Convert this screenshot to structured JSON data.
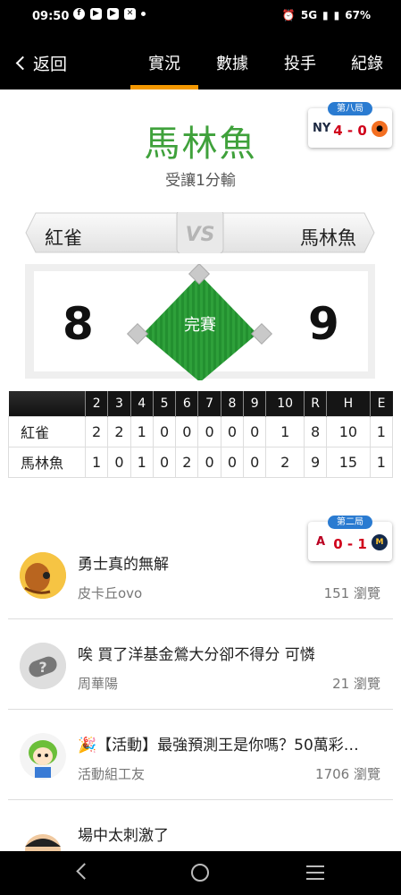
{
  "status_bar": {
    "time": "09:50",
    "network": "5G",
    "battery": "67%"
  },
  "nav": {
    "back_label": "返回",
    "tabs": [
      {
        "label": "實況",
        "active": true
      },
      {
        "label": "數據",
        "active": false
      },
      {
        "label": "投手",
        "active": false
      },
      {
        "label": "紀錄",
        "active": false
      }
    ],
    "accent_color": "#f39800"
  },
  "result": {
    "winner": "馬林魚",
    "subtitle": "受讓1分輸",
    "winner_color": "#3fa13b"
  },
  "mini_score_1": {
    "inning": "第八局",
    "score": "4 - 0",
    "away_logo": "yankees-logo",
    "home_logo": "orioles-logo"
  },
  "mini_score_2": {
    "inning": "第二局",
    "score": "0 - 1",
    "away_logo": "angels-logo",
    "home_logo": "brewers-logo"
  },
  "matchup": {
    "away_team": "紅雀",
    "home_team": "馬林魚",
    "vs": "VS",
    "away_score": "8",
    "home_score": "9",
    "status": "完賽"
  },
  "box_score": {
    "columns": [
      "2",
      "3",
      "4",
      "5",
      "6",
      "7",
      "8",
      "9",
      "10",
      "R",
      "H",
      "E"
    ],
    "rows": [
      {
        "team": "紅雀",
        "cells": [
          "2",
          "2",
          "1",
          "0",
          "0",
          "0",
          "0",
          "0",
          "1",
          "8",
          "10",
          "1"
        ]
      },
      {
        "team": "馬林魚",
        "cells": [
          "1",
          "0",
          "1",
          "0",
          "2",
          "0",
          "0",
          "0",
          "2",
          "9",
          "15",
          "1"
        ]
      }
    ]
  },
  "posts": [
    {
      "title": "勇士真的無解",
      "author": "皮卡丘ovo",
      "views": "151 瀏覽",
      "avatar": "pikachu-avatar"
    },
    {
      "title": "唉 買了洋基金鶯大分卻不得分 可憐",
      "author": "周華陽",
      "views": "21 瀏覽",
      "avatar": "default-avatar"
    },
    {
      "title": "🎉【活動】最強預測王是你嗎？50萬彩…",
      "author": "活動組工友",
      "views": "1706 瀏覽",
      "avatar": "staff-avatar"
    },
    {
      "title": "場中太刺激了",
      "author": "",
      "views": "",
      "avatar": "cartoon-avatar"
    }
  ]
}
